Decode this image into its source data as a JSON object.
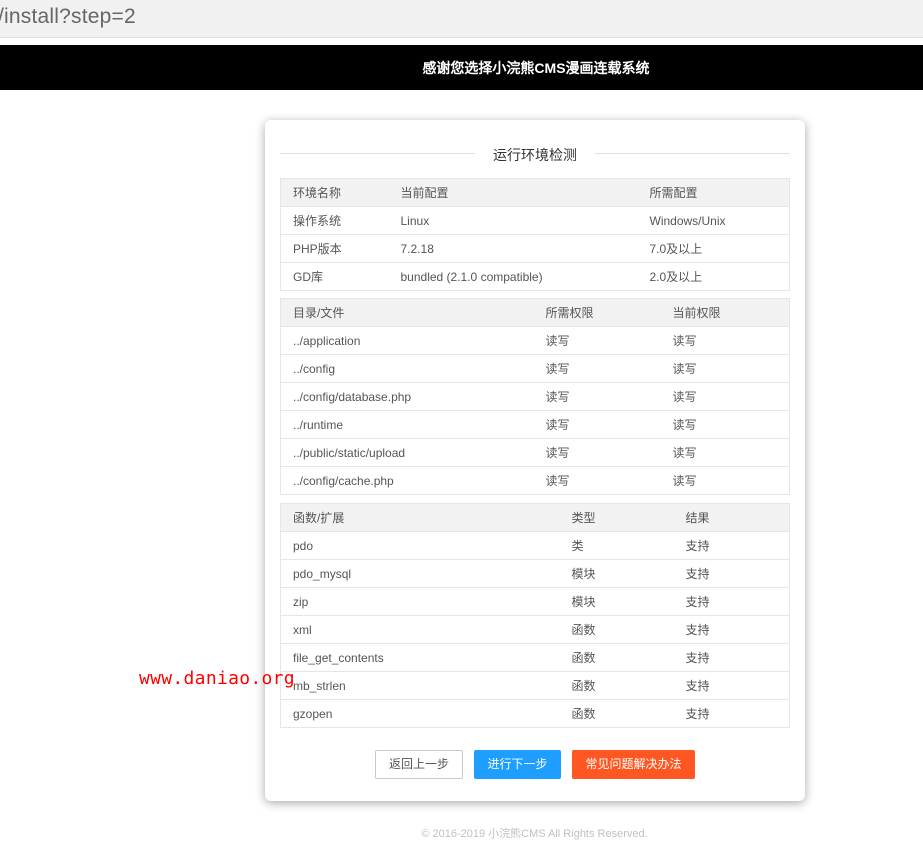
{
  "browser": {
    "url": "/install?step=2"
  },
  "header": {
    "title": "感谢您选择小浣熊CMS漫画连载系统"
  },
  "section": {
    "title": "运行环境检测"
  },
  "env_table": {
    "headers": [
      "环境名称",
      "当前配置",
      "所需配置"
    ],
    "rows": [
      [
        "操作系统",
        "Linux",
        "Windows/Unix"
      ],
      [
        "PHP版本",
        "7.2.18",
        "7.0及以上"
      ],
      [
        "GD库",
        "bundled (2.1.0 compatible)",
        "2.0及以上"
      ]
    ]
  },
  "dir_table": {
    "headers": [
      "目录/文件",
      "所需权限",
      "当前权限"
    ],
    "rows": [
      [
        "../application",
        "读写",
        "读写"
      ],
      [
        "../config",
        "读写",
        "读写"
      ],
      [
        "../config/database.php",
        "读写",
        "读写"
      ],
      [
        "../runtime",
        "读写",
        "读写"
      ],
      [
        "../public/static/upload",
        "读写",
        "读写"
      ],
      [
        "../config/cache.php",
        "读写",
        "读写"
      ]
    ]
  },
  "func_table": {
    "headers": [
      "函数/扩展",
      "类型",
      "结果"
    ],
    "rows": [
      [
        "pdo",
        "类",
        "支持"
      ],
      [
        "pdo_mysql",
        "模块",
        "支持"
      ],
      [
        "zip",
        "模块",
        "支持"
      ],
      [
        "xml",
        "函数",
        "支持"
      ],
      [
        "file_get_contents",
        "函数",
        "支持"
      ],
      [
        "mb_strlen",
        "函数",
        "支持"
      ],
      [
        "gzopen",
        "函数",
        "支持"
      ]
    ]
  },
  "buttons": {
    "back": "返回上一步",
    "next": "进行下一步",
    "faq": "常见问题解决办法"
  },
  "footer": {
    "text": "© 2016-2019 小浣熊CMS All Rights Reserved."
  },
  "watermark": {
    "text": "www.daniao.org"
  },
  "colors": {
    "primary": "#1e9fff",
    "danger": "#ff5722",
    "header_bg": "#000000",
    "watermark": "#ff0000"
  }
}
